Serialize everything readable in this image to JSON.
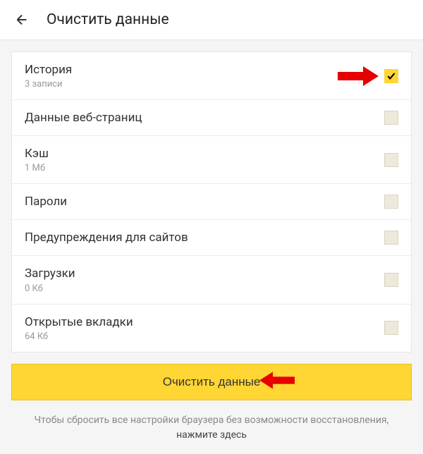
{
  "header": {
    "title": "Очистить данные"
  },
  "items": [
    {
      "title": "История",
      "subtitle": "3 записи",
      "checked": true,
      "arrow": true
    },
    {
      "title": "Данные веб-страниц",
      "subtitle": "",
      "checked": false,
      "arrow": false
    },
    {
      "title": "Кэш",
      "subtitle": "1 Мб",
      "checked": false,
      "arrow": false
    },
    {
      "title": "Пароли",
      "subtitle": "",
      "checked": false,
      "arrow": false
    },
    {
      "title": "Предупреждения для сайтов",
      "subtitle": "",
      "checked": false,
      "arrow": false
    },
    {
      "title": "Загрузки",
      "subtitle": "0 Кб",
      "checked": false,
      "arrow": false
    },
    {
      "title": "Открытые вкладки",
      "subtitle": "64 Кб",
      "checked": false,
      "arrow": false
    }
  ],
  "button": {
    "label": "Очистить данные"
  },
  "footer": {
    "text": "Чтобы сбросить все настройки браузера без возможности восстановления,",
    "link": "нажмите здесь"
  }
}
